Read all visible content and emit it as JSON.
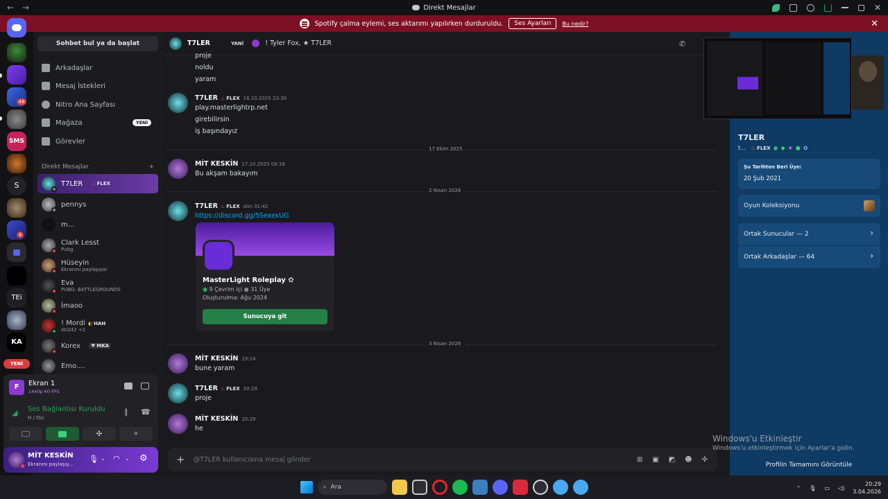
{
  "titlebar": {
    "title": "Direkt Mesajlar",
    "nav": "← →"
  },
  "banner": {
    "text": "Spotify çalma eylemi, ses aktarımı yapılırken durduruldu.",
    "button": "Ses Ayarları",
    "link": "Bu nedir?",
    "close": "✕"
  },
  "guilds": {
    "badges": [
      "48",
      "4"
    ],
    "s_letter": "S",
    "tei": "TEi",
    "ka": "KA",
    "new_pill": "YENİ",
    "sms": "SMS"
  },
  "dmcol": {
    "search": "Sohbet bul ya da başlat",
    "nav": [
      {
        "label": "Arkadaşlar"
      },
      {
        "label": "Mesaj İstekleri"
      },
      {
        "label": "Nitro Ana Sayfası"
      },
      {
        "label": "Mağaza",
        "badge": "YENİ"
      },
      {
        "label": "Görevler"
      }
    ],
    "header": "Direkt Mesajlar",
    "header_add": "+",
    "dms": [
      {
        "name": "T7LER",
        "tag": "FLEX",
        "sub": ""
      },
      {
        "name": "pennys",
        "sub": ""
      },
      {
        "name": "m...",
        "sub": ""
      },
      {
        "name": "Clark Lesst",
        "sub": "Pubg"
      },
      {
        "name": "Hüseyin",
        "sub": "Ekranını paylaşıyor"
      },
      {
        "name": "Eva",
        "sub": "PUBG: BATTLEGROUNDS"
      },
      {
        "name": "İmaoo",
        "sub": ""
      },
      {
        "name": "! Mordi",
        "tag": "HAH",
        "sub": "Ati242 +1"
      },
      {
        "name": "Korex",
        "tag": "MKA",
        "sub": ""
      },
      {
        "name": "Emo....",
        "sub": ""
      }
    ]
  },
  "voice": {
    "stream_title": "Ekran 1",
    "stream_quality": "1440p 60 FPS",
    "stream_avatar": "F",
    "conn": "Ses Bağlantısı Kuruldu",
    "conn_sub": "H / Osi"
  },
  "user": {
    "name": "MİT KESKİN",
    "status": "Ekranını paylaşıy..."
  },
  "channel": {
    "name": "T7LER",
    "tag": "YANİ",
    "members": "! Tyler Fox, ★ T7LER"
  },
  "messages": {
    "top_lines": [
      "proje",
      "noldu",
      "yaram"
    ],
    "m1": {
      "author": "T7LER",
      "tag": "FLEX",
      "time": "16.10.2025 23:39",
      "lines": [
        "play.masterlightrp.net",
        "girebilirsin",
        "iş başındayız"
      ]
    },
    "div1": "17 Ekim 2025",
    "m2": {
      "author": "MİT KESKİN",
      "time": "17.10.2025 08:18",
      "lines": [
        "Bu akşam bakayım"
      ]
    },
    "div2": "2 Nisan 2026",
    "m3": {
      "author": "T7LER",
      "tag": "FLEX",
      "time": "dün 01:42",
      "link": "https://discord.gg/5SexexUG"
    },
    "card": {
      "title": "MasterLight Roleplay",
      "online": "9 Çevrim içi",
      "members": "31 Üye",
      "created": "Oluşturulma: Ağu 2024",
      "button": "Sunucuya git"
    },
    "div3": "3 Nisan 2026",
    "m4": {
      "author": "MİT KESKİN",
      "time": "19:14",
      "lines": [
        "bune yaram"
      ]
    },
    "m5": {
      "author": "T7LER",
      "tag": "FLEX",
      "time": "20:29",
      "lines": [
        "proje"
      ]
    },
    "m6": {
      "author": "MİT KESKİN",
      "time": "20:29",
      "lines": [
        "he"
      ]
    }
  },
  "input": {
    "placeholder": "@T7LER kullanıcısına mesaj gönder"
  },
  "profile": {
    "name": "T7LER",
    "short": "t...",
    "tag": "FLEX",
    "since_label": "Şu Tarihten Beri Üye:",
    "since": "20 Şub 2021",
    "games": "Oyun Koleksiyonu",
    "servers": "Ortak Sunucular — 2",
    "friends": "Ortak Arkadaşlar — 64",
    "full": "Profilin Tamamını Görüntüle"
  },
  "watermark": {
    "title": "Windows'u Etkinleştir",
    "sub": "Windows'u etkinleştirmek için Ayarlar'a gidin."
  },
  "taskbar": {
    "search": "Ara",
    "time": "20:29",
    "date": "3.04.2026"
  },
  "colors": {
    "accent": "#5865f2",
    "banner": "#7d1024",
    "online": "#23a55a",
    "dnd": "#f23f43",
    "profile_bg": "#0e3a63"
  }
}
